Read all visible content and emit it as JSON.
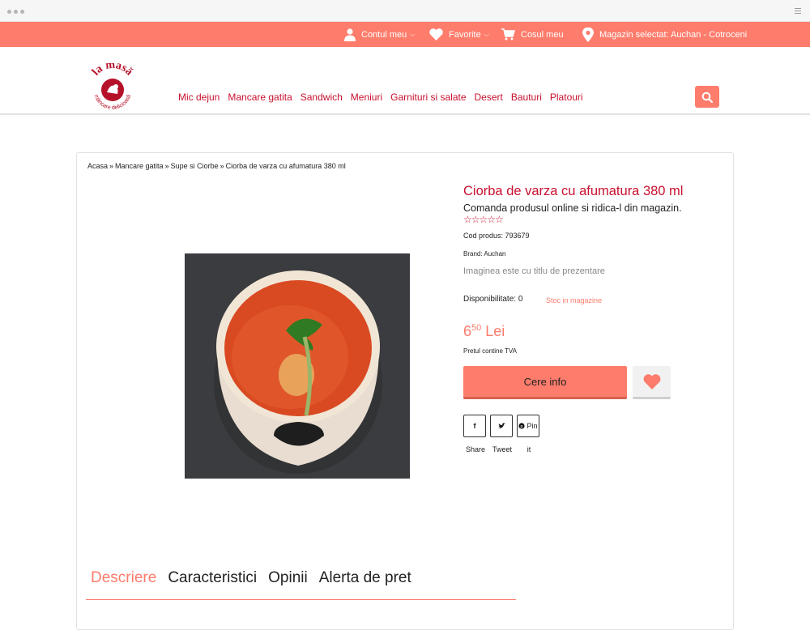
{
  "topbar": {
    "account": "Contul meu",
    "favorites": "Favorite",
    "cart": "Cosul meu",
    "store": "Magazin selectat: Auchan - Cotroceni"
  },
  "logo": {
    "text": "la masă",
    "tagline": "mâncare delicioasă"
  },
  "nav": [
    "Mic dejun",
    "Mancare gatita",
    "Sandwich",
    "Meniuri",
    "Garnituri si salate",
    "Desert",
    "Bauturi",
    "Platouri"
  ],
  "breadcrumb": [
    "Acasa",
    "Mancare gatita",
    "Supe si Ciorbe",
    "Ciorba de varza cu afumatura 380 ml"
  ],
  "product": {
    "title": "Ciorba de varza cu afumatura 380 ml",
    "subtitle": "Comanda produsul online si ridica-l din magazin.",
    "rating_stars": "☆☆☆☆☆",
    "code": "Cod produs: 793679",
    "brand": "Brand: Auchan",
    "image_note": "Imaginea este cu titlu de prezentare",
    "availability": "Disponibilitate: 0",
    "stock_link": "Stoc in magazine",
    "price_int": "6",
    "price_dec": "50",
    "price_currency": "Lei",
    "vat": "Pretul contine TVA",
    "cta": "Cere info"
  },
  "share": {
    "facebook": "Share",
    "twitter": "Tweet",
    "pinterest": "Pin",
    "pinterest_label": "it"
  },
  "tabs": [
    "Descriere",
    "Caracteristici",
    "Opinii",
    "Alerta de pret"
  ],
  "colors": {
    "accent": "#fd7c6c",
    "brand_red": "#c8102e"
  }
}
